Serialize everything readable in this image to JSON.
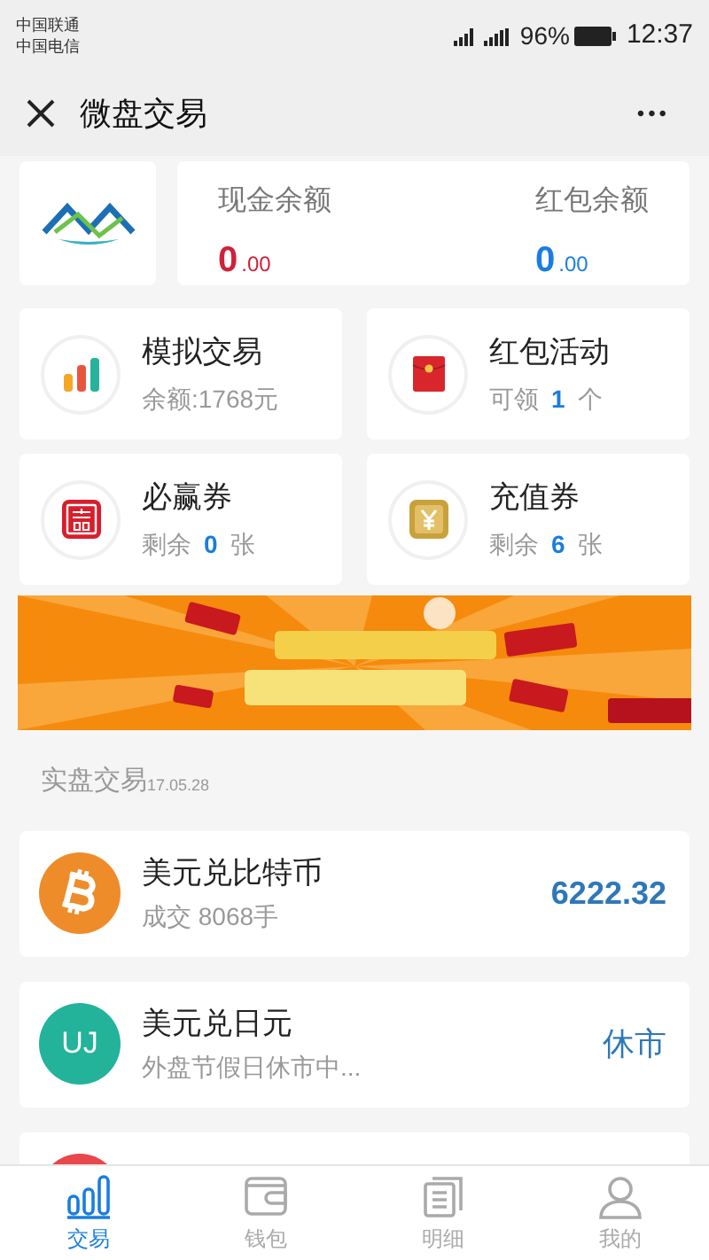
{
  "status_bar": {
    "carriers": [
      "中国联通",
      "中国电信"
    ],
    "battery": "96%",
    "time": "12:37"
  },
  "header": {
    "title": "微盘交易",
    "more": "•••"
  },
  "balances": [
    {
      "label": "现金余额",
      "integer": "0",
      "decimal": ".00",
      "color": "#d0213a"
    },
    {
      "label": "红包余额",
      "integer": "0",
      "decimal": ".00",
      "color": "#1a7de0"
    }
  ],
  "features": [
    {
      "kind": "chart",
      "title": "模拟交易",
      "prefix": "余额:1768元"
    },
    {
      "kind": "redpacket",
      "title": "红包活动",
      "prefix": "可领",
      "count": "1",
      "unit": "个"
    },
    {
      "kind": "win",
      "title": "必赢券",
      "prefix": "剩余",
      "count": "0",
      "unit": "张"
    },
    {
      "kind": "yen",
      "title": "充值券",
      "prefix": "剩余",
      "count": "6",
      "unit": "张"
    }
  ],
  "section": {
    "title": "实盘交易",
    "date": "17.05.28"
  },
  "markets": [
    {
      "kind": "bitcoin",
      "name": "美元兑比特币",
      "detail": "成交 8068手",
      "value": "6222.32"
    },
    {
      "kind": "initials",
      "initials": "UJ",
      "name": "美元兑日元",
      "detail": "外盘节假日休市中...",
      "value": "休市"
    },
    {
      "kind": "partial"
    }
  ],
  "tabs": [
    {
      "label": "交易",
      "selected": true
    },
    {
      "label": "钱包",
      "selected": false
    },
    {
      "label": "明细",
      "selected": false
    },
    {
      "label": "我的",
      "selected": false
    }
  ]
}
